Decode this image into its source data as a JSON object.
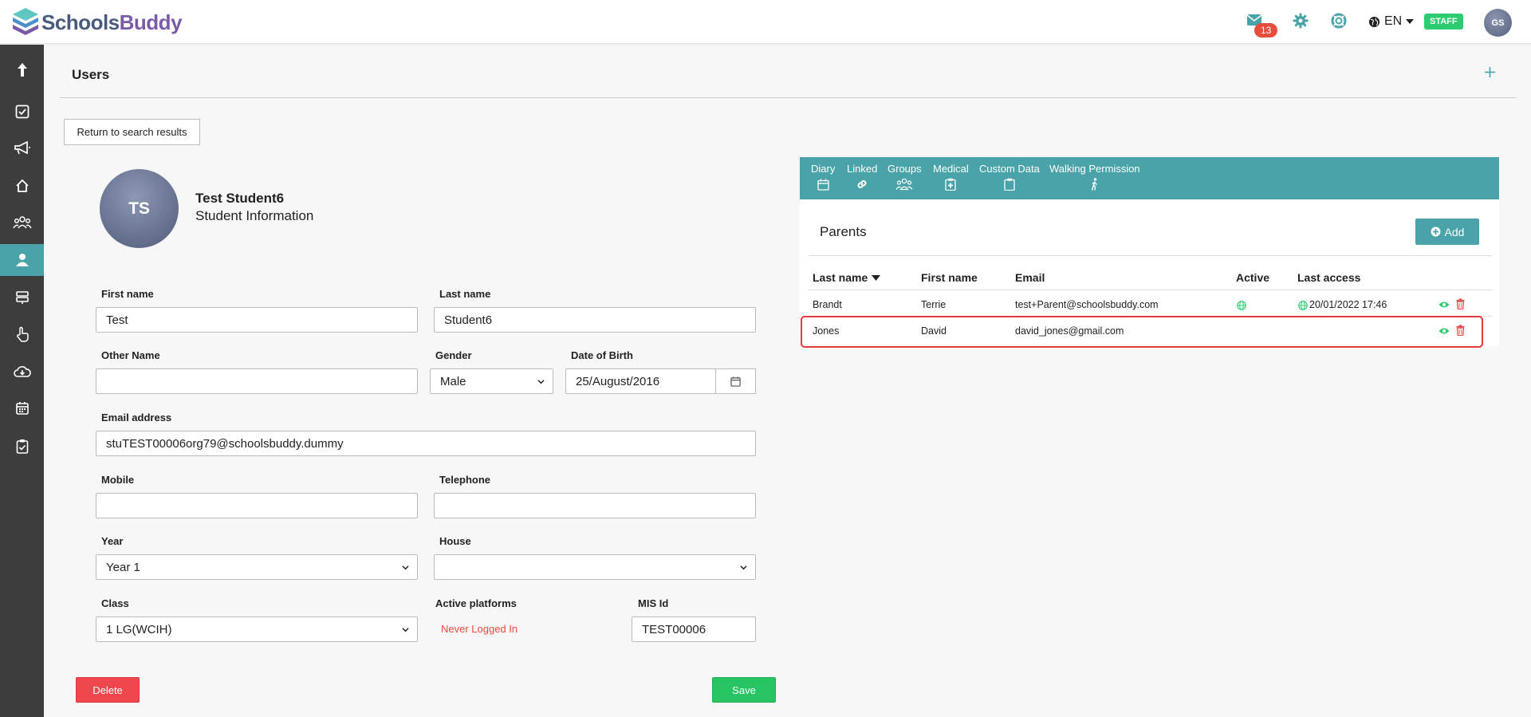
{
  "brand": {
    "part1": "Schools",
    "part2": "Buddy"
  },
  "header": {
    "mail_count": "13",
    "language": "EN",
    "role_badge": "STAFF",
    "user_initials": "GS"
  },
  "sidebar": {
    "items": [
      "upload-icon",
      "checklist-icon",
      "megaphone-icon",
      "home-icon",
      "group-icon",
      "user-icon",
      "signpost-icon",
      "hand-pointer-icon",
      "cloud-download-icon",
      "calendar-icon",
      "clipboard-check-icon"
    ],
    "active_index": 5
  },
  "page": {
    "title": "Users",
    "return_label": "Return to search results"
  },
  "student": {
    "initials": "TS",
    "name": "Test Student6",
    "subtitle": "Student Information"
  },
  "form": {
    "first_name_label": "First name",
    "first_name": "Test",
    "last_name_label": "Last name",
    "last_name": "Student6",
    "other_name_label": "Other Name",
    "other_name": "",
    "gender_label": "Gender",
    "gender": "Male",
    "dob_label": "Date of Birth",
    "dob": "25/August/2016",
    "email_label": "Email address",
    "email": "stuTEST00006org79@schoolsbuddy.dummy",
    "mobile_label": "Mobile",
    "mobile": "",
    "telephone_label": "Telephone",
    "telephone": "",
    "year_label": "Year",
    "year": "Year 1",
    "house_label": "House",
    "house": "",
    "class_label": "Class",
    "class": "1 LG(WCIH)",
    "platforms_label": "Active platforms",
    "platforms": "Never Logged In",
    "mis_label": "MIS Id",
    "mis": "TEST00006",
    "delete_label": "Delete",
    "save_label": "Save"
  },
  "tabs": [
    {
      "label": "Diary",
      "icon": "calendar-icon"
    },
    {
      "label": "Linked",
      "icon": "link-icon",
      "active": true
    },
    {
      "label": "Groups",
      "icon": "group-icon"
    },
    {
      "label": "Medical",
      "icon": "medical-clipboard-icon"
    },
    {
      "label": "Custom Data",
      "icon": "clipboard-icon"
    },
    {
      "label": "Walking Permission",
      "icon": "walking-icon"
    }
  ],
  "parents": {
    "title": "Parents",
    "add_label": "Add",
    "columns": [
      "Last name",
      "First name",
      "Email",
      "Active",
      "Last access"
    ],
    "rows": [
      {
        "last": "Brandt",
        "first": "Terrie",
        "email": "test+Parent@schoolsbuddy.com",
        "active": "globe-icon",
        "last_access": "20/01/2022 17:46"
      },
      {
        "last": "Jones",
        "first": "David",
        "email": "david_jones@gmail.com",
        "active": "",
        "last_access": ""
      }
    ]
  },
  "colors": {
    "accent": "#4aa3a8",
    "sidebar": "#3d3d3d",
    "danger": "#f0474e",
    "success": "#27c463",
    "badge": "#e74c3c",
    "staff": "#2ecc71"
  }
}
